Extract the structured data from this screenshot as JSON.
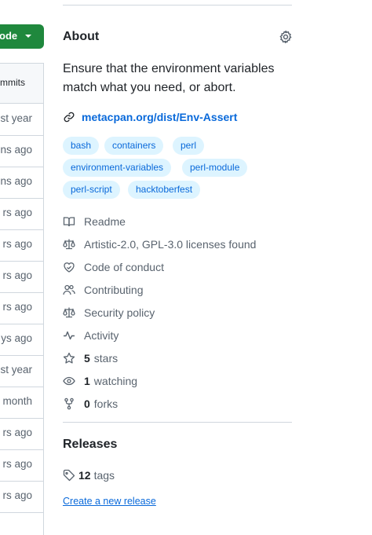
{
  "left": {
    "code_button_label": "ode",
    "commits_header": "mmits",
    "row_times": [
      "st year",
      "ns ago",
      "ns ago",
      "rs ago",
      "rs ago",
      "rs ago",
      "rs ago",
      "ys ago",
      "st year",
      "month",
      "rs ago",
      "rs ago",
      "rs ago"
    ]
  },
  "about": {
    "title": "About",
    "description": "Ensure that the environment variables match what you need, or abort.",
    "homepage": "metacpan.org/dist/Env-Assert",
    "topics": [
      "bash",
      "containers",
      "perl",
      "environment-variables",
      "perl-module",
      "perl-script",
      "hacktoberfest"
    ]
  },
  "meta": {
    "readme": "Readme",
    "license": "Artistic-2.0, GPL-3.0 licenses found",
    "conduct": "Code of conduct",
    "contributing": "Contributing",
    "security": "Security policy",
    "activity": "Activity",
    "stars_count": "5",
    "stars_label": "stars",
    "watching_count": "1",
    "watching_label": "watching",
    "forks_count": "0",
    "forks_label": "forks"
  },
  "releases": {
    "title": "Releases",
    "tags_count": "12",
    "tags_label": "tags",
    "create_link": "Create a new release"
  }
}
